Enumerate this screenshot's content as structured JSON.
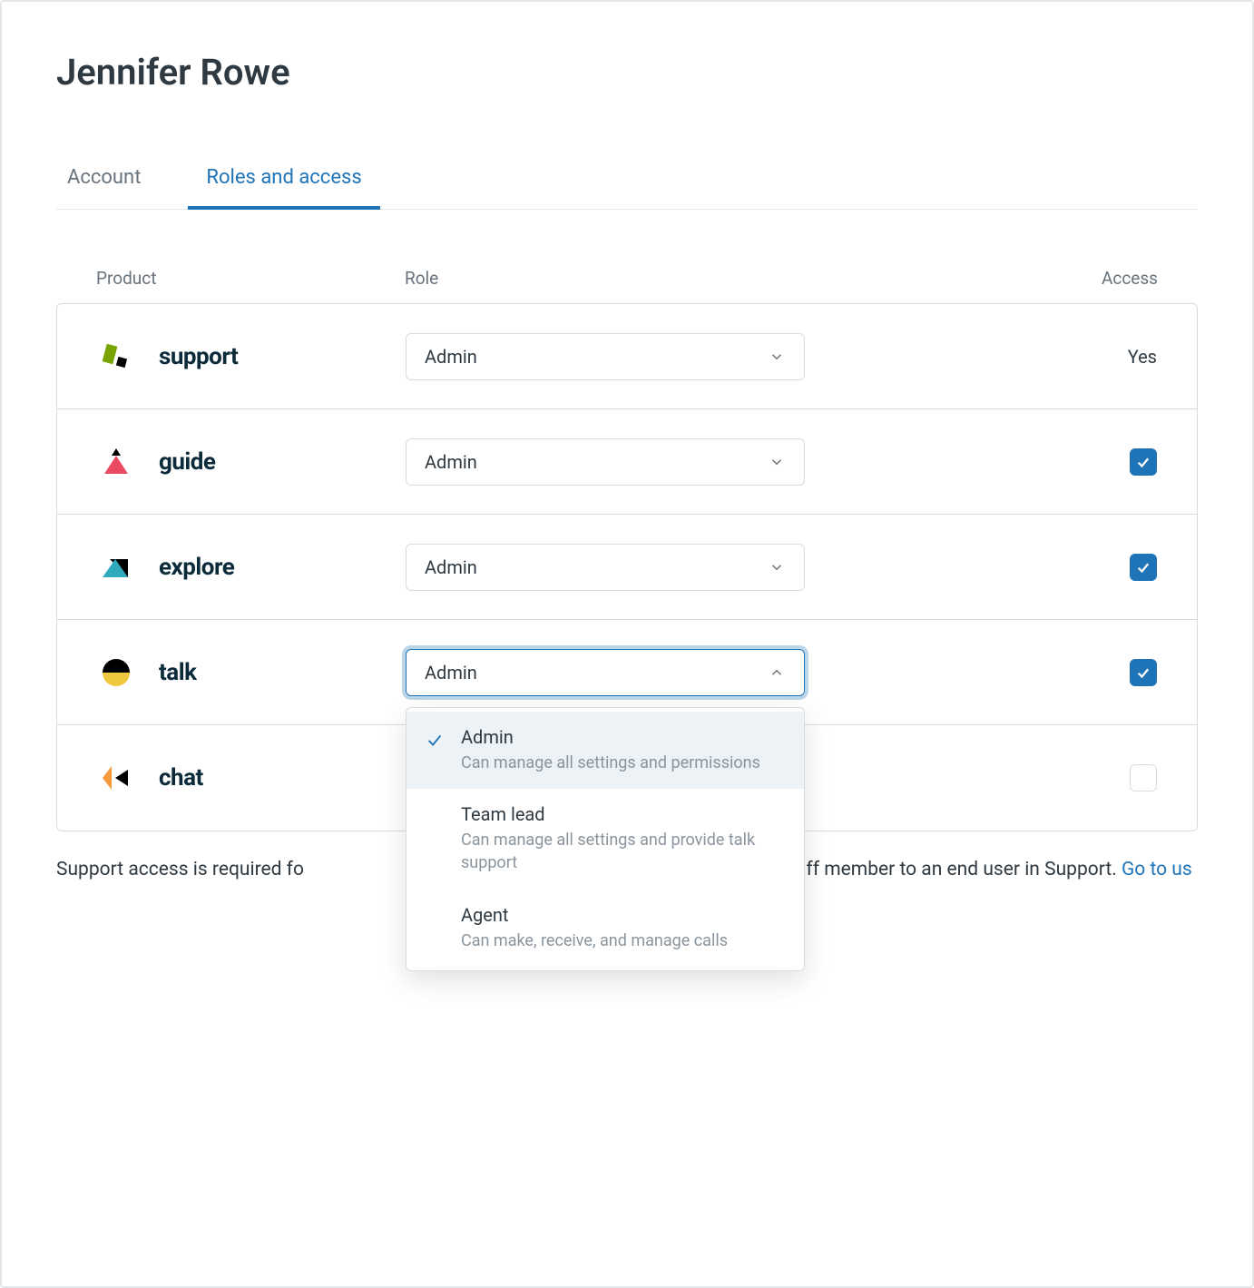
{
  "page": {
    "title": "Jennifer Rowe"
  },
  "tabs": {
    "account": "Account",
    "roles": "Roles and access",
    "active": "roles"
  },
  "headers": {
    "product": "Product",
    "role": "Role",
    "access": "Access"
  },
  "rows": [
    {
      "icon": "support-icon",
      "product": "support",
      "role": "Admin",
      "access_type": "text",
      "access_text": "Yes",
      "open": false
    },
    {
      "icon": "guide-icon",
      "product": "guide",
      "role": "Admin",
      "access_type": "checkbox",
      "checked": true,
      "open": false
    },
    {
      "icon": "explore-icon",
      "product": "explore",
      "role": "Admin",
      "access_type": "checkbox",
      "checked": true,
      "open": false
    },
    {
      "icon": "talk-icon",
      "product": "talk",
      "role": "Admin",
      "access_type": "checkbox",
      "checked": true,
      "open": true
    },
    {
      "icon": "chat-icon",
      "product": "chat",
      "role": "",
      "access_type": "checkbox",
      "checked": false,
      "open": false
    }
  ],
  "dropdown": {
    "options": [
      {
        "title": "Admin",
        "desc": "Can manage all settings and permissions",
        "selected": true
      },
      {
        "title": "Team lead",
        "desc": "Can manage all settings and provide talk support",
        "selected": false
      },
      {
        "title": "Agent",
        "desc": "Can make, receive, and manage calls",
        "selected": false
      }
    ]
  },
  "footer": {
    "text_before": "Support access is required fo",
    "text_after": "e this staff member to an end user in Support. ",
    "link": "Go to us"
  }
}
